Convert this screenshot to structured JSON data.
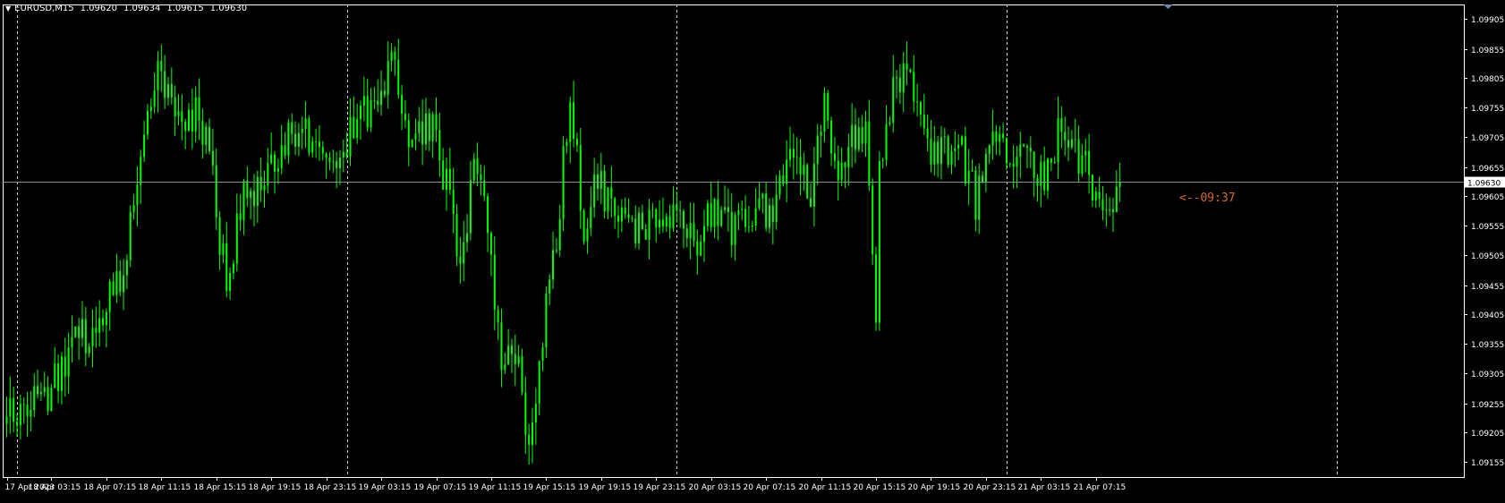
{
  "header": {
    "symbol": "EURUSD,M15",
    "open": "1.09620",
    "high": "1.09634",
    "low": "1.09615",
    "close": "1.09630"
  },
  "countdown": "<--09:37",
  "colors": {
    "background": "#000000",
    "candle": "#00ff00",
    "grid": "#ffffff",
    "bid_line": "#8a8f96",
    "countdown": "#d9692b",
    "axis_text": "#ffffff"
  },
  "chart_data": {
    "type": "candlestick",
    "symbol": "EURUSD",
    "timeframe": "M15",
    "ylim": [
      1.0913,
      1.0993
    ],
    "current_price": 1.0963,
    "current_price_label": "1.09630",
    "y_ticks": [
      "1.09905",
      "1.09855",
      "1.09805",
      "1.09755",
      "1.09705",
      "1.09655",
      "1.09605",
      "1.09555",
      "1.09505",
      "1.09455",
      "1.09405",
      "1.09355",
      "1.09305",
      "1.09255",
      "1.09205",
      "1.09155"
    ],
    "x_ticks": [
      {
        "label": "17 Apr 2023",
        "bar": 0
      },
      {
        "label": "18 Apr 03:15",
        "bar": 13
      },
      {
        "label": "18 Apr 07:15",
        "bar": 29
      },
      {
        "label": "18 Apr 11:15",
        "bar": 45
      },
      {
        "label": "18 Apr 15:15",
        "bar": 61
      },
      {
        "label": "18 Apr 19:15",
        "bar": 77
      },
      {
        "label": "18 Apr 23:15",
        "bar": 93
      },
      {
        "label": "19 Apr 03:15",
        "bar": 109
      },
      {
        "label": "19 Apr 07:15",
        "bar": 125
      },
      {
        "label": "19 Apr 11:15",
        "bar": 141
      },
      {
        "label": "19 Apr 15:15",
        "bar": 157
      },
      {
        "label": "19 Apr 19:15",
        "bar": 173
      },
      {
        "label": "19 Apr 23:15",
        "bar": 189
      },
      {
        "label": "20 Apr 03:15",
        "bar": 205
      },
      {
        "label": "20 Apr 07:15",
        "bar": 221
      },
      {
        "label": "20 Apr 11:15",
        "bar": 237
      },
      {
        "label": "20 Apr 15:15",
        "bar": 253
      },
      {
        "label": "20 Apr 19:15",
        "bar": 269
      },
      {
        "label": "20 Apr 23:15",
        "bar": 285
      },
      {
        "label": "21 Apr 03:15",
        "bar": 301
      },
      {
        "label": "21 Apr 07:15",
        "bar": 317
      }
    ],
    "period_separators": [
      3,
      99,
      195,
      291,
      387
    ],
    "anchors": [
      [
        0,
        1.0922
      ],
      [
        6,
        1.0926
      ],
      [
        12,
        1.0927
      ],
      [
        18,
        1.0935
      ],
      [
        24,
        1.0937
      ],
      [
        32,
        1.0945
      ],
      [
        36,
        1.0955
      ],
      [
        40,
        1.097
      ],
      [
        44,
        1.098
      ],
      [
        48,
        1.0975
      ],
      [
        56,
        1.0975
      ],
      [
        60,
        1.0963
      ],
      [
        64,
        1.0945
      ],
      [
        68,
        1.096
      ],
      [
        72,
        1.0962
      ],
      [
        78,
        1.0968
      ],
      [
        84,
        1.0972
      ],
      [
        92,
        1.097
      ],
      [
        96,
        1.0968
      ],
      [
        100,
        1.0972
      ],
      [
        108,
        1.0976
      ],
      [
        112,
        1.0983
      ],
      [
        116,
        1.0972
      ],
      [
        120,
        1.0972
      ],
      [
        124,
        1.0972
      ],
      [
        128,
        1.0962
      ],
      [
        132,
        1.095
      ],
      [
        136,
        1.0965
      ],
      [
        140,
        1.0955
      ],
      [
        144,
        1.093
      ],
      [
        148,
        1.0935
      ],
      [
        152,
        1.092
      ],
      [
        156,
        1.0938
      ],
      [
        160,
        1.0955
      ],
      [
        164,
        1.0976
      ],
      [
        168,
        1.0955
      ],
      [
        172,
        1.0965
      ],
      [
        176,
        1.0958
      ],
      [
        180,
        1.0955
      ],
      [
        188,
        1.0957
      ],
      [
        196,
        1.0955
      ],
      [
        200,
        1.0952
      ],
      [
        206,
        1.0958
      ],
      [
        212,
        1.0955
      ],
      [
        218,
        1.096
      ],
      [
        222,
        1.0958
      ],
      [
        226,
        1.0965
      ],
      [
        230,
        1.097
      ],
      [
        234,
        1.096
      ],
      [
        238,
        1.0975
      ],
      [
        242,
        1.0965
      ],
      [
        246,
        1.0972
      ],
      [
        250,
        1.097
      ],
      [
        252,
        1.095
      ],
      [
        253,
        1.094
      ],
      [
        254,
        1.0965
      ],
      [
        258,
        1.0978
      ],
      [
        262,
        1.0983
      ],
      [
        266,
        1.0975
      ],
      [
        270,
        1.0967
      ],
      [
        274,
        1.0968
      ],
      [
        278,
        1.0968
      ],
      [
        282,
        1.096
      ],
      [
        286,
        1.097
      ],
      [
        290,
        1.097
      ],
      [
        294,
        1.0968
      ],
      [
        298,
        1.0966
      ],
      [
        302,
        1.0962
      ],
      [
        306,
        1.0972
      ],
      [
        310,
        1.0968
      ],
      [
        314,
        1.0965
      ],
      [
        318,
        1.096
      ],
      [
        322,
        1.0958
      ],
      [
        324,
        1.0963
      ]
    ]
  }
}
